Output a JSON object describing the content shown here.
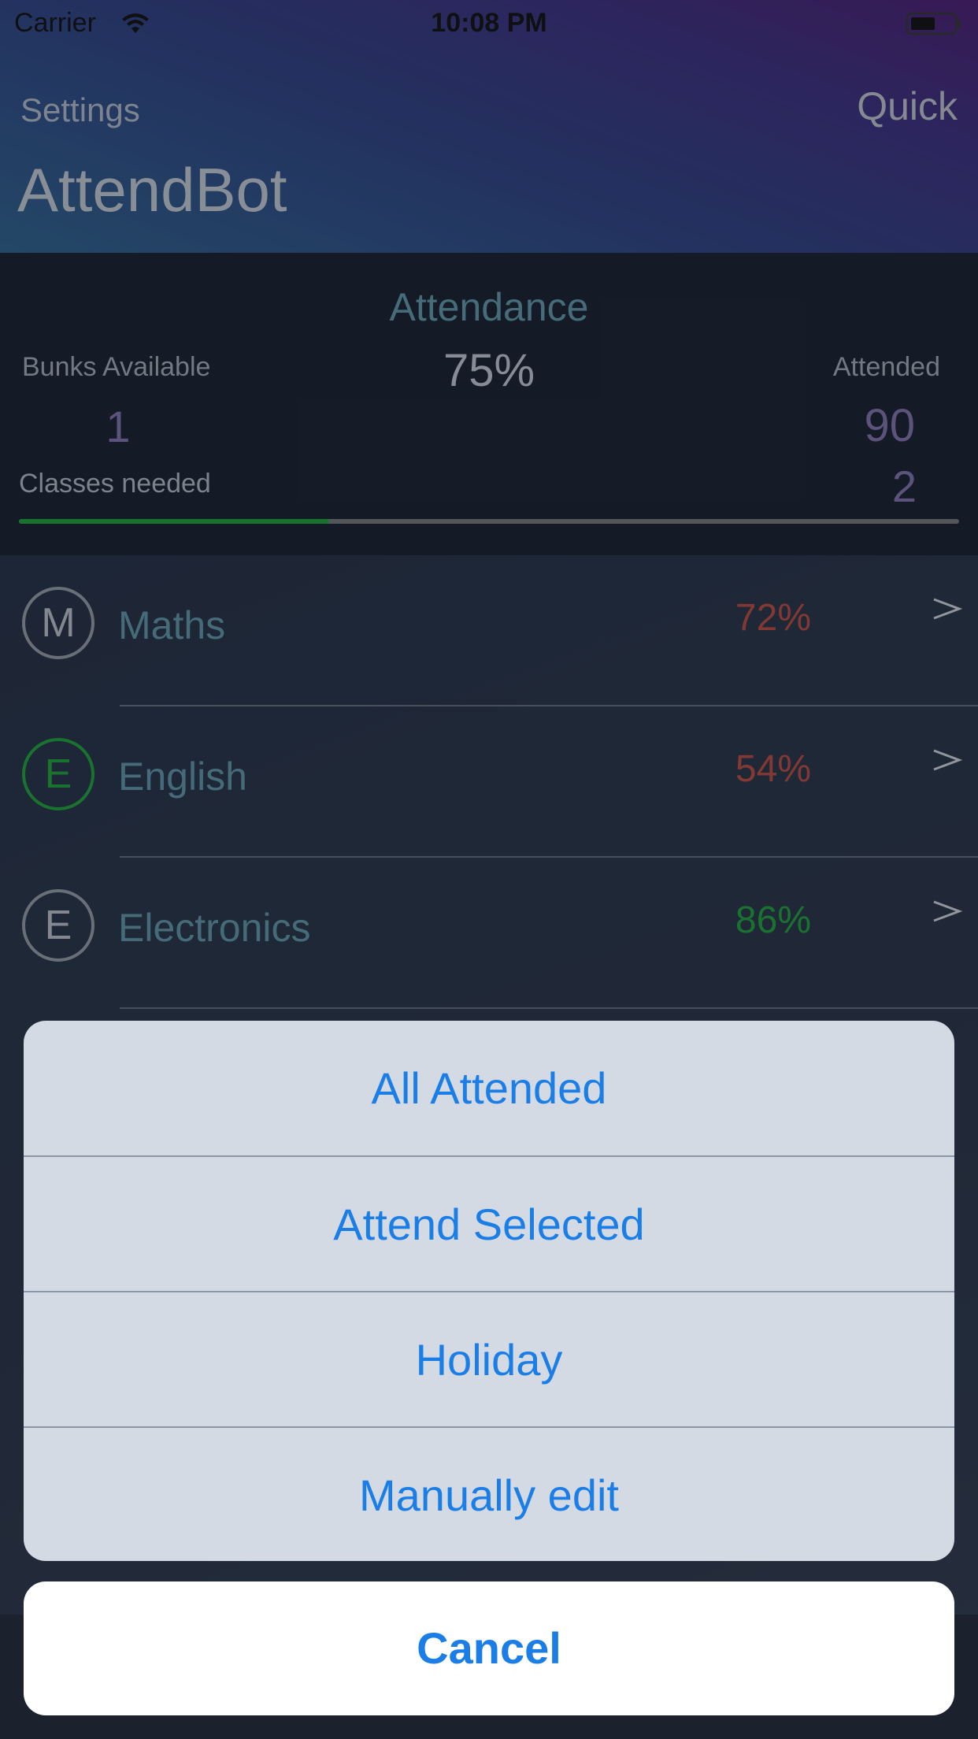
{
  "status_bar": {
    "carrier": "Carrier",
    "time": "10:08 PM"
  },
  "nav": {
    "left_label": "Settings",
    "right_label": "Quick",
    "title": "AttendBot"
  },
  "summary": {
    "attendance_title": "Attendance",
    "attendance_percent": "75%",
    "bunks_label": "Bunks Available",
    "bunks_value": "1",
    "attended_label": "Attended",
    "attended_value": "90",
    "needed_label": "Classes needed",
    "needed_value": "2",
    "progress_fraction": 0.33,
    "progress_color": "#1f9a3a"
  },
  "subjects": [
    {
      "initial": "M",
      "name": "Maths",
      "percent": "72%",
      "percent_color": "#b04a3f",
      "ring": "gray"
    },
    {
      "initial": "E",
      "name": "English",
      "percent": "54%",
      "percent_color": "#b04a3f",
      "ring": "green"
    },
    {
      "initial": "E",
      "name": "Electronics",
      "percent": "86%",
      "percent_color": "#1f9a3a",
      "ring": "gray"
    }
  ],
  "action_sheet": {
    "actions": [
      {
        "label": "All Attended"
      },
      {
        "label": "Attend Selected"
      },
      {
        "label": "Holiday"
      },
      {
        "label": "Manually edit"
      }
    ],
    "cancel_label": "Cancel",
    "accent_color": "#1a7ee6"
  }
}
